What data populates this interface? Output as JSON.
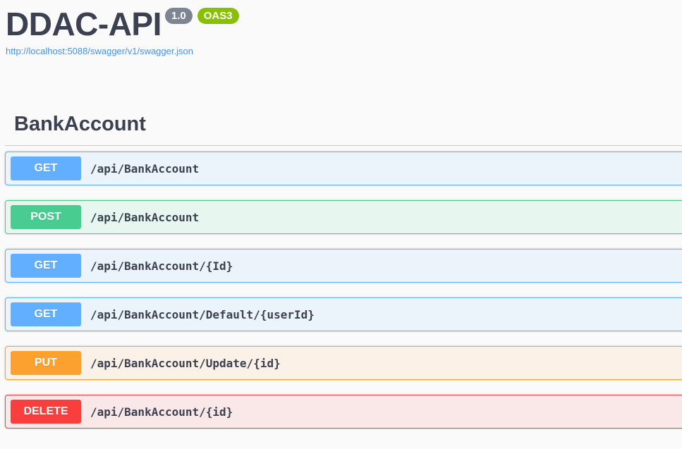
{
  "info": {
    "title": "DDAC-API",
    "version": "1.0",
    "oas": "OAS3",
    "url": "http://localhost:5088/swagger/v1/swagger.json"
  },
  "colors": {
    "get": "#61affe",
    "post": "#49cc90",
    "put": "#fca130",
    "delete": "#f93e3e",
    "link": "#4990e2"
  },
  "tag": {
    "name": "BankAccount",
    "operations": [
      {
        "method": "GET",
        "path": "/api/BankAccount"
      },
      {
        "method": "POST",
        "path": "/api/BankAccount"
      },
      {
        "method": "GET",
        "path": "/api/BankAccount/{Id}"
      },
      {
        "method": "GET",
        "path": "/api/BankAccount/Default/{userId}"
      },
      {
        "method": "PUT",
        "path": "/api/BankAccount/Update/{id}"
      },
      {
        "method": "DELETE",
        "path": "/api/BankAccount/{id}"
      }
    ]
  }
}
